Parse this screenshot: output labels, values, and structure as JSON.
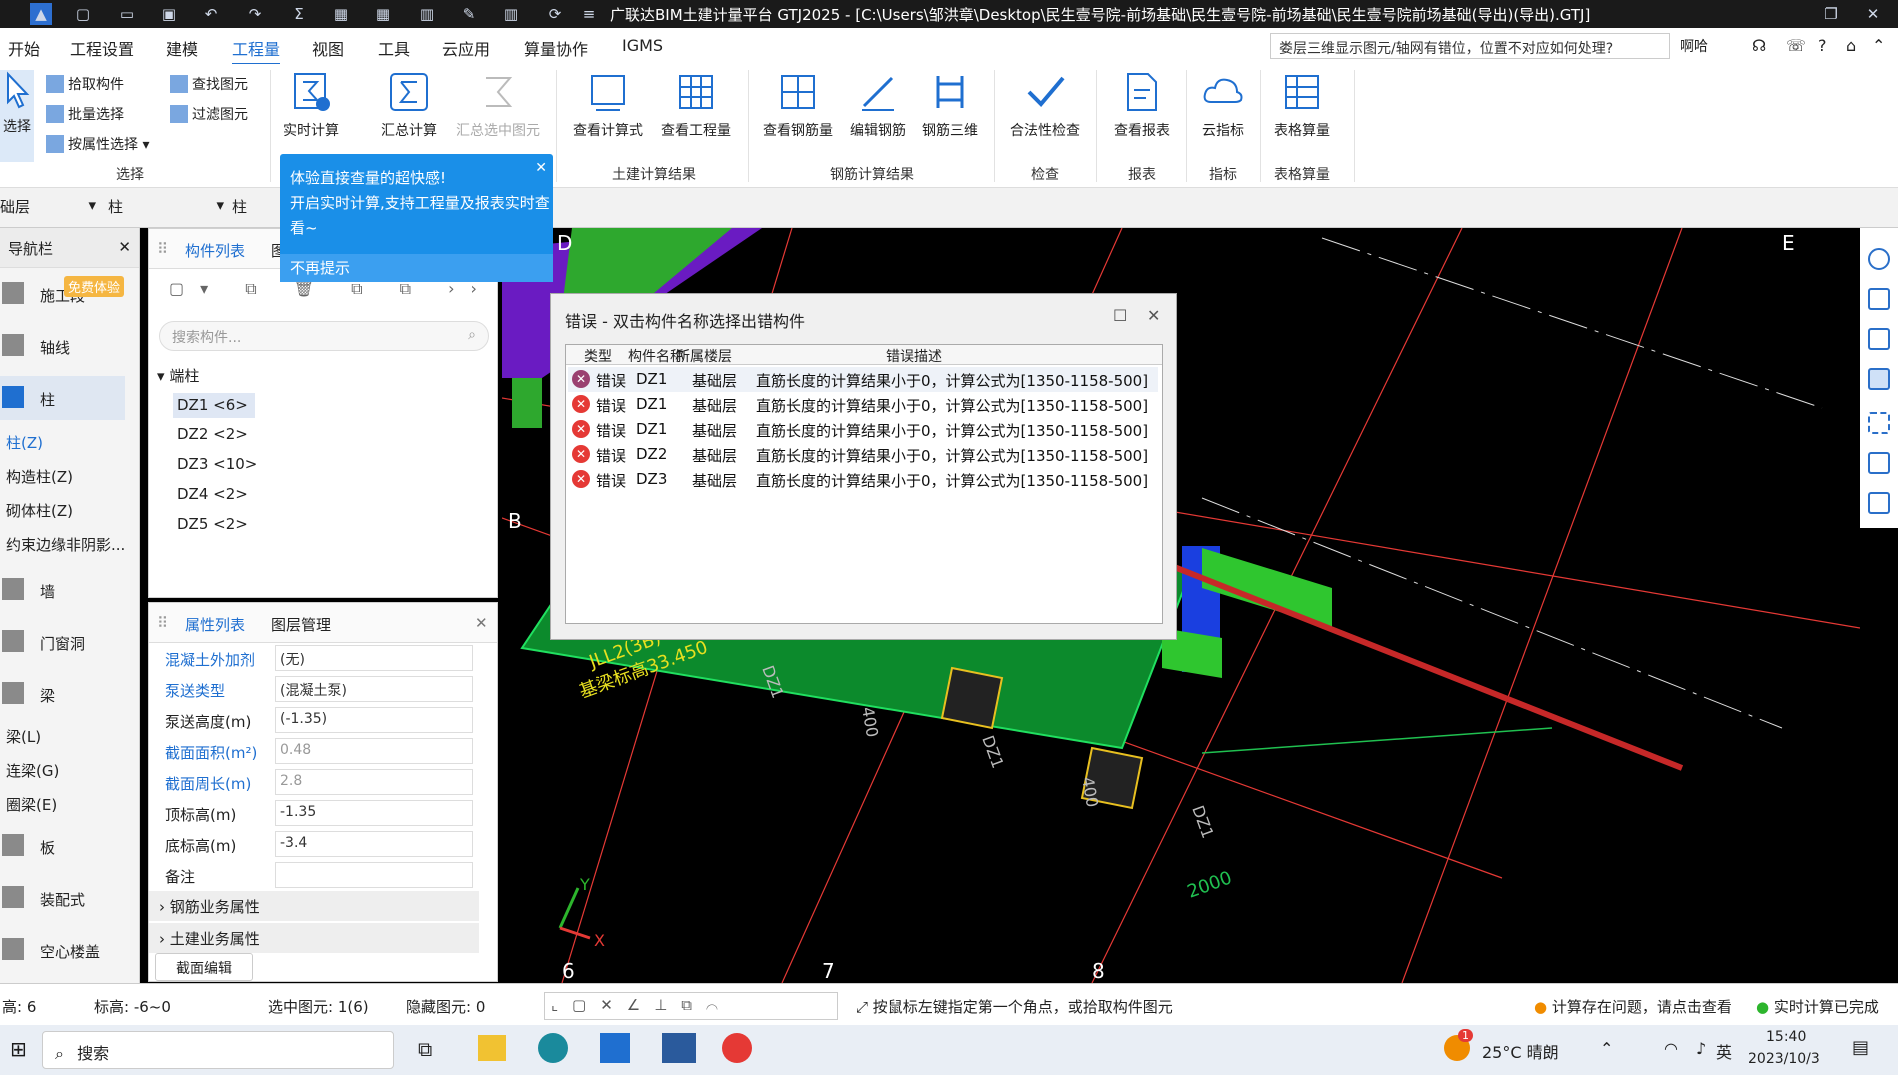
{
  "titlebar": {
    "title": "广联达BIM土建计量平台 GTJ2025 - [C:\\Users\\邹洪章\\Desktop\\民生壹号院-前场基础\\民生壹号院-前场基础\\民生壹号院前场基础(导出)(导出).GTJ]"
  },
  "menu": {
    "items": [
      "开始",
      "工程设置",
      "建模",
      "工程量",
      "视图",
      "工具",
      "云应用",
      "算量协作",
      "IGMS"
    ],
    "help_search": "娄层三维显示图元/轴网有错位，位置不对应如何处理?",
    "user": "啊哈"
  },
  "ribbon": {
    "select_btn": "选择",
    "pick": "拾取构件",
    "batch": "批量选择",
    "by_attr": "按属性选择",
    "find": "查找图元",
    "filter": "过滤图元",
    "group_select": "选择",
    "realtime": "实时计算",
    "summary": "汇总计算",
    "summary_sel": "汇总选中图元",
    "view_formula": "查看计算式",
    "view_qty": "查看工程量",
    "group_civil": "土建计算结果",
    "view_rebar": "查看钢筋量",
    "edit_rebar": "编辑钢筋",
    "rebar_3d": "钢筋三维",
    "group_rebar": "钢筋计算结果",
    "legal_check": "合法性检查",
    "group_check": "检查",
    "view_report": "查看报表",
    "group_report": "报表",
    "cloud_index": "云指标",
    "group_index": "指标",
    "table_calc": "表格算量",
    "group_table": "表格算量"
  },
  "selrow": {
    "floor": "础层",
    "type1": "柱",
    "type2": "柱"
  },
  "nav": {
    "title": "导航栏",
    "trial": "免费体验",
    "items": [
      "施工段",
      "轴线",
      "柱",
      "墙",
      "门窗洞",
      "梁",
      "板",
      "装配式",
      "空心楼盖"
    ],
    "col_sub": [
      "柱(Z)",
      "构造柱(Z)",
      "砌体柱(Z)",
      "约束边缘非阴影..."
    ],
    "beam_sub": [
      "梁(L)",
      "连梁(G)",
      "圈梁(E)"
    ]
  },
  "comp": {
    "tab1": "构件列表",
    "tab2": "图",
    "search_placeholder": "搜索构件...",
    "group": "端柱",
    "items": [
      "DZ1 <6>",
      "DZ2 <2>",
      "DZ3 <10>",
      "DZ4 <2>",
      "DZ5 <2>"
    ]
  },
  "prop": {
    "tab1": "属性列表",
    "tab2": "图层管理",
    "rows": [
      {
        "k": "混凝土外加剂",
        "v": "(无)"
      },
      {
        "k": "泵送类型",
        "v": "(混凝土泵)"
      },
      {
        "k": "泵送高度(m)",
        "v": "(-1.35)"
      },
      {
        "k": "截面面积(m²)",
        "v": "0.48"
      },
      {
        "k": "截面周长(m)",
        "v": "2.8"
      },
      {
        "k": "顶标高(m)",
        "v": "-1.35"
      },
      {
        "k": "底标高(m)",
        "v": "-3.4"
      },
      {
        "k": "备注",
        "v": ""
      }
    ],
    "rebar_attr": "钢筋业务属性",
    "civil_attr": "土建业务属性",
    "section_edit": "截面编辑"
  },
  "tip": {
    "line1": "体验直接查量的超快感!",
    "line2": "开启实时计算,支持工程量及报表实时查看~",
    "dismiss": "不再提示"
  },
  "error_dialog": {
    "title": "错误 - 双击构件名称选择出错构件",
    "headers": [
      "类型",
      "构件名称",
      "所属楼层",
      "错误描述"
    ],
    "rows": [
      {
        "type": "错误",
        "name": "DZ1",
        "floor": "基础层",
        "desc": "直筋长度的计算结果小于0，计算公式为[1350-1158-500]"
      },
      {
        "type": "错误",
        "name": "DZ1",
        "floor": "基础层",
        "desc": "直筋长度的计算结果小于0，计算公式为[1350-1158-500]"
      },
      {
        "type": "错误",
        "name": "DZ1",
        "floor": "基础层",
        "desc": "直筋长度的计算结果小于0，计算公式为[1350-1158-500]"
      },
      {
        "type": "错误",
        "name": "DZ2",
        "floor": "基础层",
        "desc": "直筋长度的计算结果小于0，计算公式为[1350-1158-500]"
      },
      {
        "type": "错误",
        "name": "DZ3",
        "floor": "基础层",
        "desc": "直筋长度的计算结果小于0，计算公式为[1350-1158-500]"
      }
    ]
  },
  "viewport": {
    "axis_labels": [
      "D",
      "E",
      "B",
      "6",
      "7",
      "8"
    ],
    "beam_label": "JLL2(3B)",
    "elev_label": "基梁标高33.450",
    "dim1": "400",
    "dim2": "400",
    "dim3": "2000",
    "dz_labels": [
      "DZ1",
      "DZ1",
      "DZ1"
    ],
    "axis_x": "X",
    "axis_y": "Y"
  },
  "status": {
    "floor_h": "高: 6",
    "elev": "标高: -6~0",
    "selected": "选中图元: 1(6)",
    "hidden": "隐藏图元: 0",
    "hint": "按鼠标左键指定第一个角点，或拾取构件图元",
    "warn": "计算存在问题，请点击查看",
    "ok": "实时计算已完成"
  },
  "taskbar": {
    "search": "搜索",
    "weather": "25°C 晴朗",
    "lang": "英",
    "time": "15:40",
    "date": "2023/10/3",
    "badge": "1"
  },
  "colors": {
    "accent": "#1f6fd0",
    "tip_bg": "#1a8fe8",
    "error_red": "#e53935",
    "arrow": "#c62828"
  }
}
